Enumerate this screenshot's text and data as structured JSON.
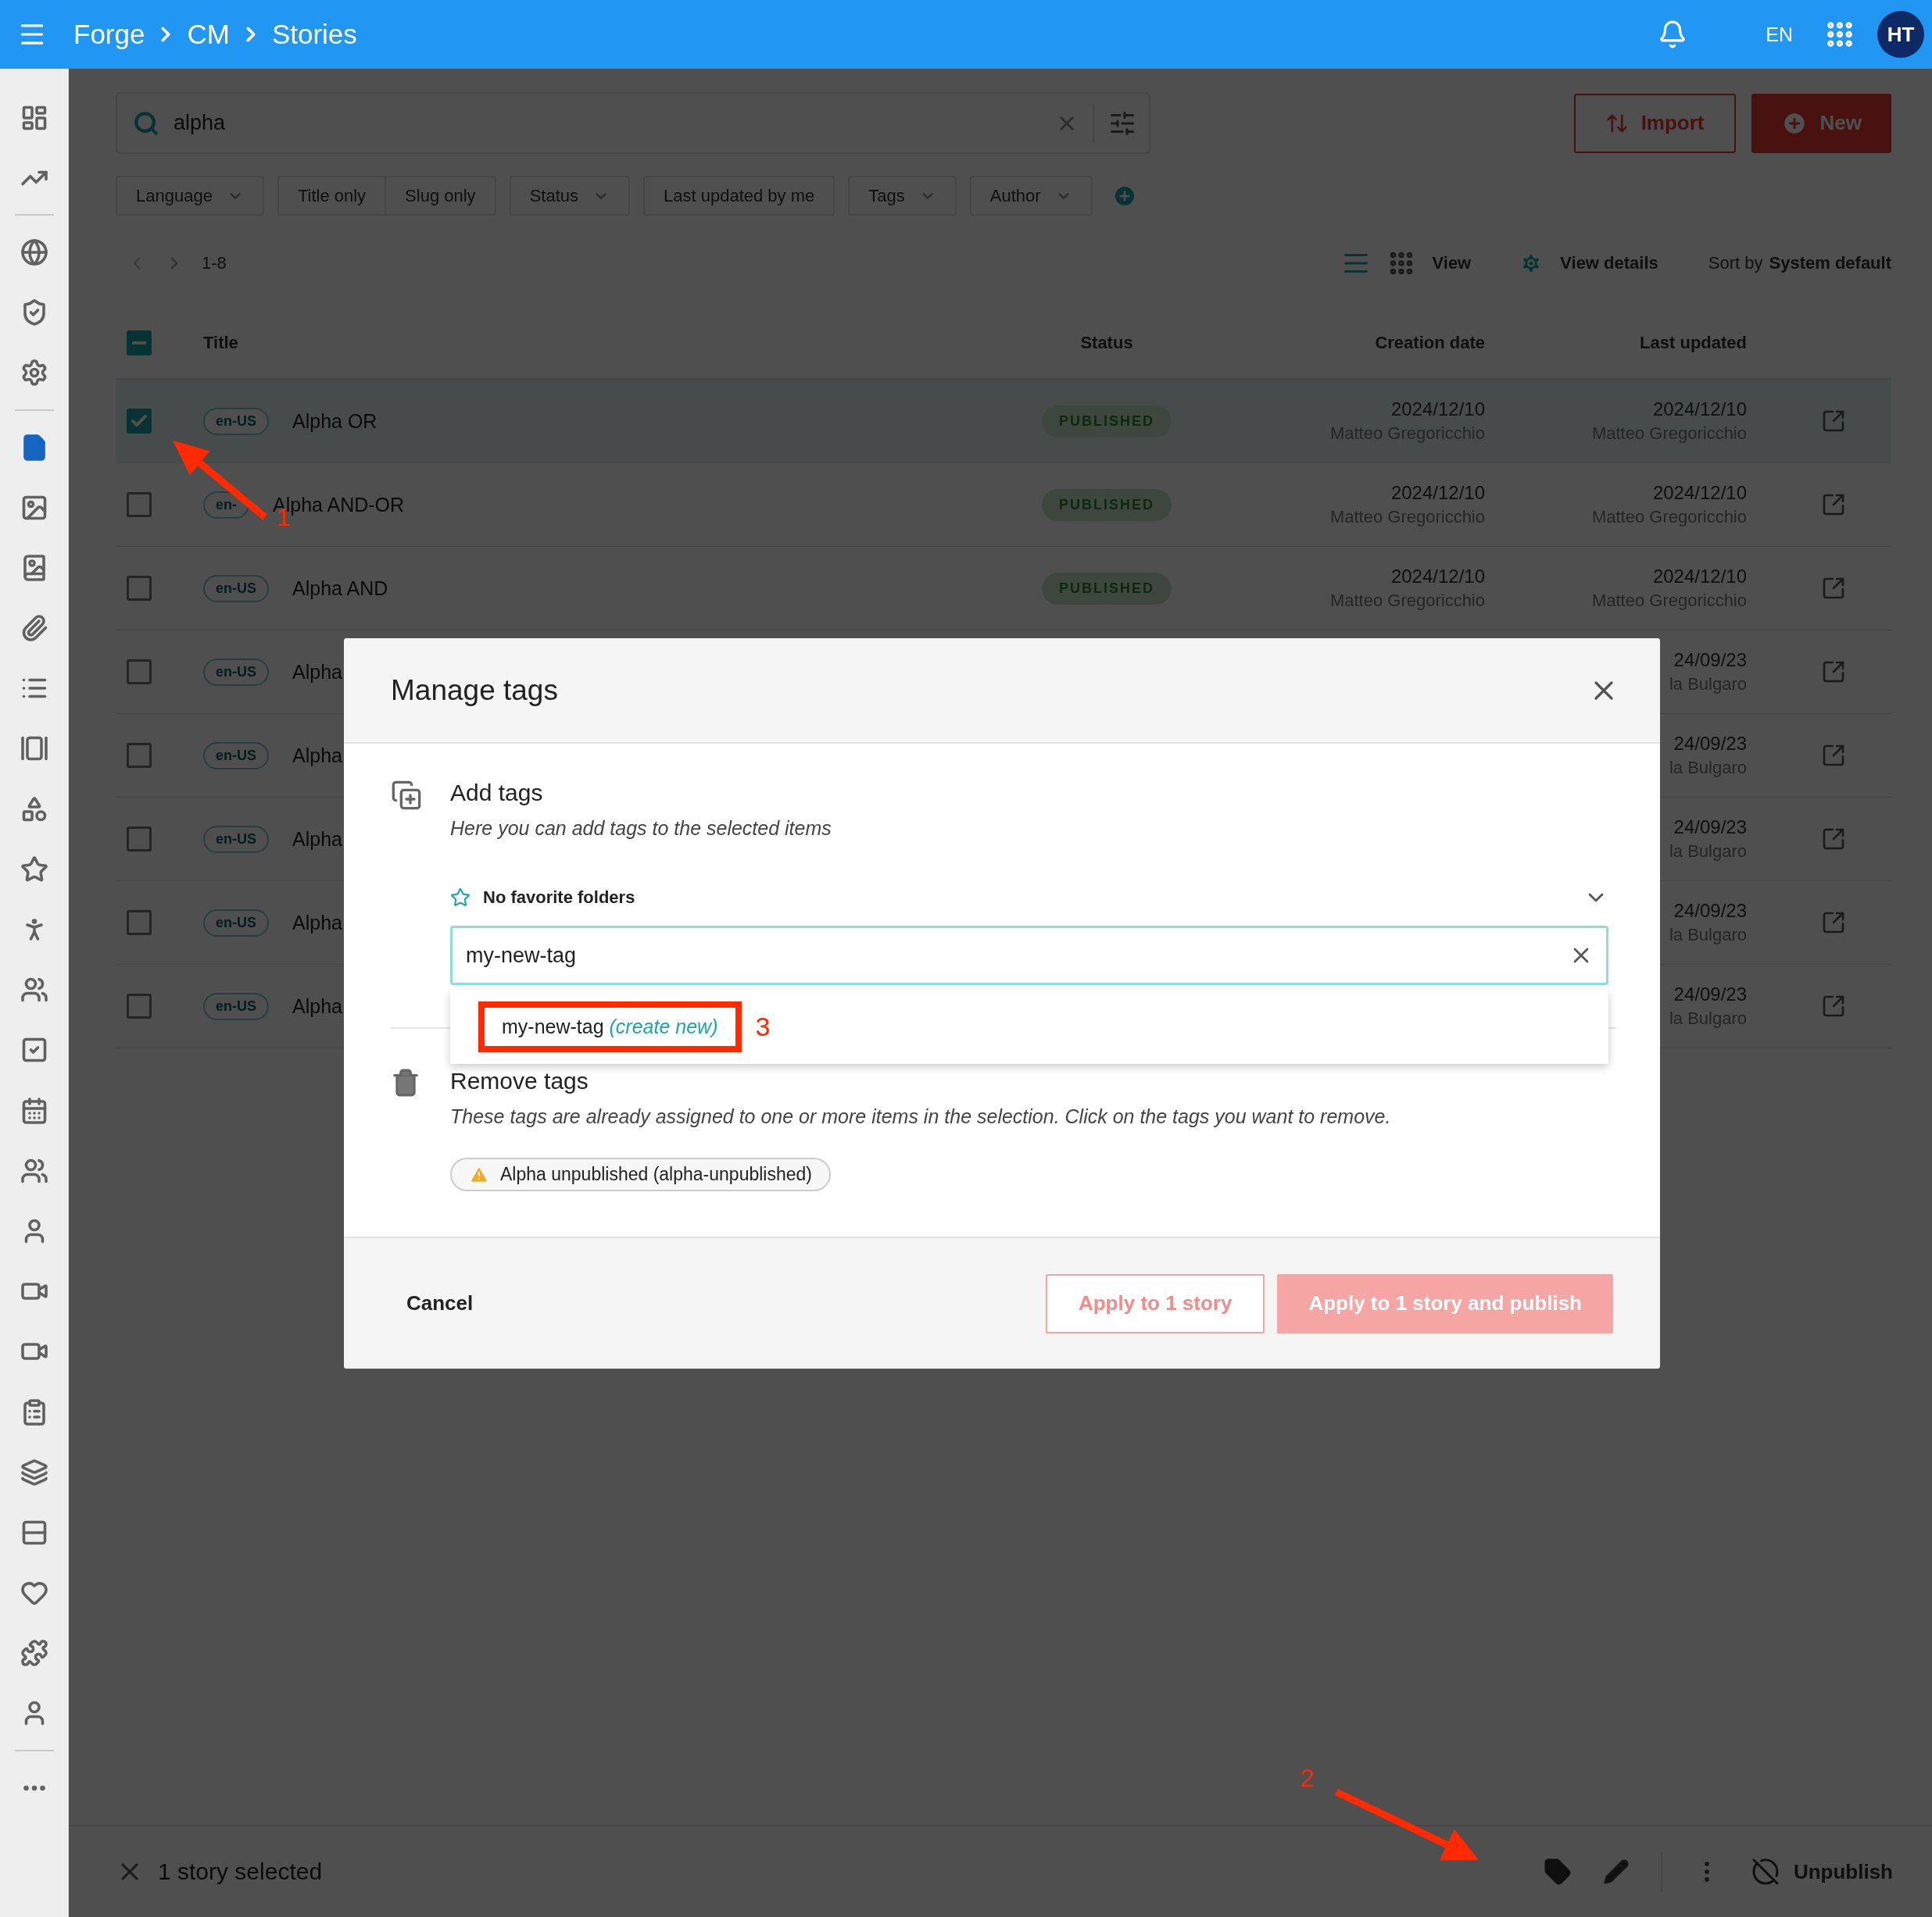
{
  "app_bar": {
    "breadcrumbs": [
      "Forge",
      "CM",
      "Stories"
    ],
    "language": "EN",
    "avatar": "HT"
  },
  "sidebar": {
    "items": [
      {
        "kind": "icon",
        "selected": false
      },
      {
        "kind": "icon",
        "selected": false
      },
      {
        "kind": "divider"
      },
      {
        "kind": "icon",
        "selected": false
      },
      {
        "kind": "icon",
        "selected": false
      },
      {
        "kind": "icon",
        "selected": false
      },
      {
        "kind": "divider"
      },
      {
        "kind": "icon",
        "selected": true
      },
      {
        "kind": "icon",
        "selected": false
      },
      {
        "kind": "icon",
        "selected": false
      },
      {
        "kind": "icon",
        "selected": false
      },
      {
        "kind": "icon",
        "selected": false
      },
      {
        "kind": "icon",
        "selected": false
      },
      {
        "kind": "icon",
        "selected": false
      },
      {
        "kind": "icon",
        "selected": false
      },
      {
        "kind": "icon",
        "selected": false
      },
      {
        "kind": "icon",
        "selected": false
      },
      {
        "kind": "icon",
        "selected": false
      },
      {
        "kind": "icon",
        "selected": false
      },
      {
        "kind": "icon",
        "selected": false
      },
      {
        "kind": "icon",
        "selected": false
      },
      {
        "kind": "icon",
        "selected": false
      },
      {
        "kind": "icon",
        "selected": false
      },
      {
        "kind": "icon",
        "selected": false
      },
      {
        "kind": "icon",
        "selected": false
      },
      {
        "kind": "icon",
        "selected": false
      },
      {
        "kind": "icon",
        "selected": false
      },
      {
        "kind": "icon",
        "selected": false
      },
      {
        "kind": "icon",
        "selected": false
      },
      {
        "kind": "divider"
      },
      {
        "kind": "icon",
        "selected": false
      }
    ]
  },
  "search": {
    "value": "alpha"
  },
  "actions": [
    {
      "label": "Import",
      "kind": "outlined"
    },
    {
      "label": "New",
      "kind": "filled"
    }
  ],
  "filters": [
    {
      "label": "Language",
      "kind": "dropdown"
    },
    {
      "label": "Title only",
      "kind": "toggle-left"
    },
    {
      "label": "Slug only",
      "kind": "toggle-right"
    },
    {
      "label": "Status",
      "kind": "dropdown"
    },
    {
      "label": "Last updated by me",
      "kind": "toggle"
    },
    {
      "label": "Tags",
      "kind": "dropdown"
    },
    {
      "label": "Author",
      "kind": "dropdown"
    }
  ],
  "pagination": {
    "range": "1-8"
  },
  "view": {
    "view_label": "View",
    "details_label": "View details",
    "sort_prefix": "Sort by",
    "sort_value": "System default"
  },
  "table": {
    "some_selected": true,
    "columns": [
      "Title",
      "Status",
      "Creation date",
      "Last updated"
    ],
    "rows": [
      {
        "checked": true,
        "language": "en-US",
        "title": "Alpha OR",
        "status": "PUBLISHED",
        "created": "2024/12/10",
        "created_by": "Matteo Gregoricchio",
        "updated": "2024/12/10",
        "updated_by": "Matteo Gregoricchio"
      },
      {
        "checked": false,
        "language": "en-",
        "title": "Alpha AND-OR",
        "status": "PUBLISHED",
        "created": "2024/12/10",
        "created_by": "Matteo Gregoricchio",
        "updated": "2024/12/10",
        "updated_by": "Matteo Gregoricchio"
      },
      {
        "checked": false,
        "language": "en-US",
        "title": "Alpha AND",
        "status": "PUBLISHED",
        "created": "2024/12/10",
        "created_by": "Matteo Gregoricchio",
        "updated": "2024/12/10",
        "updated_by": "Matteo Gregoricchio"
      },
      {
        "checked": false,
        "language": "en-US",
        "title": "Alpha",
        "updated": "24/09/23",
        "updated_by": "la Bulgaro"
      },
      {
        "checked": false,
        "language": "en-US",
        "title": "Alpha",
        "updated": "24/09/23",
        "updated_by": "la Bulgaro"
      },
      {
        "checked": false,
        "language": "en-US",
        "title": "Alpha",
        "updated": "24/09/23",
        "updated_by": "la Bulgaro"
      },
      {
        "checked": false,
        "language": "en-US",
        "title": "Alpha",
        "updated": "24/09/23",
        "updated_by": "la Bulgaro"
      },
      {
        "checked": false,
        "language": "en-US",
        "title": "Alpha",
        "updated": "24/09/23",
        "updated_by": "la Bulgaro"
      }
    ]
  },
  "modal": {
    "title": "Manage tags",
    "add": {
      "title": "Add tags",
      "subtitle": "Here you can add tags to the selected items",
      "favorites": "No favorite folders",
      "input_value": "my-new-tag",
      "suggestion": {
        "text": "my-new-tag",
        "hint": "(create new)"
      }
    },
    "remove": {
      "title": "Remove tags",
      "subtitle": "These tags are already assigned to one or more items in the selection. Click on the tags you want to remove.",
      "tags": [
        {
          "label": "Alpha unpublished (alpha-unpublished)",
          "warning": true
        }
      ]
    },
    "buttons": [
      {
        "label": "Cancel",
        "kind": "text"
      },
      {
        "label": "Apply to 1 story",
        "kind": "outlined",
        "disabled": true
      },
      {
        "label": "Apply to 1 story and publish",
        "kind": "filled",
        "disabled": true
      }
    ]
  },
  "selection_bar": {
    "text": "1 story selected",
    "action": "Unpublish"
  },
  "annotations": [
    {
      "kind": "arrow",
      "label": "1"
    },
    {
      "kind": "arrow",
      "label": "2"
    },
    {
      "kind": "box",
      "label": "3"
    }
  ]
}
